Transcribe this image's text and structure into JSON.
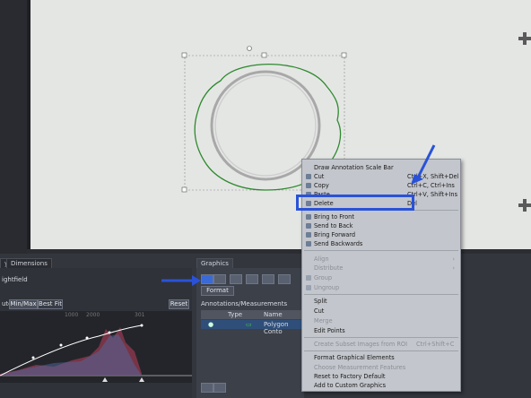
{
  "tabs": {
    "left_tab1": "y",
    "left_tab2": "Dimensions",
    "graphics_tab": "Graphics"
  },
  "left_pane": {
    "channel_label": "ightfield",
    "auto_label": "uto",
    "minmax_tab": "Min/Max",
    "bestfit_tab": "Best Fit",
    "reset_label": "Reset",
    "axis_ticks": [
      "1000",
      "2000",
      "301"
    ]
  },
  "graphics_pane": {
    "format_label": "Format",
    "annotations_title": "Annotations/Measurements",
    "col_type": "Type",
    "col_name": "Name",
    "row_name": "Polygon Conto"
  },
  "context_menu": {
    "items": [
      {
        "label": "Draw Annotation Scale Bar",
        "shortcut": "",
        "disabled": false
      },
      {
        "label": "Cut",
        "shortcut": "Ctrl+X, Shift+Del",
        "disabled": false
      },
      {
        "label": "Copy",
        "shortcut": "Ctrl+C, Ctrl+Ins",
        "disabled": false
      },
      {
        "label": "Paste",
        "shortcut": "Ctrl+V, Shift+Ins",
        "disabled": false
      },
      {
        "label": "Delete",
        "shortcut": "Del",
        "disabled": false
      },
      {
        "label": "Bring to Front",
        "shortcut": "",
        "disabled": false
      },
      {
        "label": "Send to Back",
        "shortcut": "",
        "disabled": false
      },
      {
        "label": "Bring Forward",
        "shortcut": "",
        "disabled": false
      },
      {
        "label": "Send Backwards",
        "shortcut": "",
        "disabled": false
      },
      {
        "label": "Align",
        "shortcut": "",
        "disabled": true
      },
      {
        "label": "Distribute",
        "shortcut": "",
        "disabled": true
      },
      {
        "label": "Group",
        "shortcut": "",
        "disabled": true
      },
      {
        "label": "Ungroup",
        "shortcut": "",
        "disabled": true
      },
      {
        "label": "Split",
        "shortcut": "",
        "disabled": false
      },
      {
        "label": "Cut",
        "shortcut": "",
        "disabled": false
      },
      {
        "label": "Merge",
        "shortcut": "",
        "disabled": true
      },
      {
        "label": "Edit Points",
        "shortcut": "",
        "disabled": false
      },
      {
        "label": "Create Subset Images from ROI",
        "shortcut": "Ctrl+Shift+C",
        "disabled": true
      },
      {
        "label": "Format Graphical Elements",
        "shortcut": "",
        "disabled": false
      },
      {
        "label": "Choose Measurement Features",
        "shortcut": "",
        "disabled": true
      },
      {
        "label": "Reset to Factory Default",
        "shortcut": "",
        "disabled": false
      },
      {
        "label": "Add to Custom Graphics",
        "shortcut": "",
        "disabled": false
      }
    ]
  },
  "colors": {
    "highlight": "#2a52d8",
    "menu_bg": "#c3c6cc",
    "contour": "#2f8a2f"
  }
}
